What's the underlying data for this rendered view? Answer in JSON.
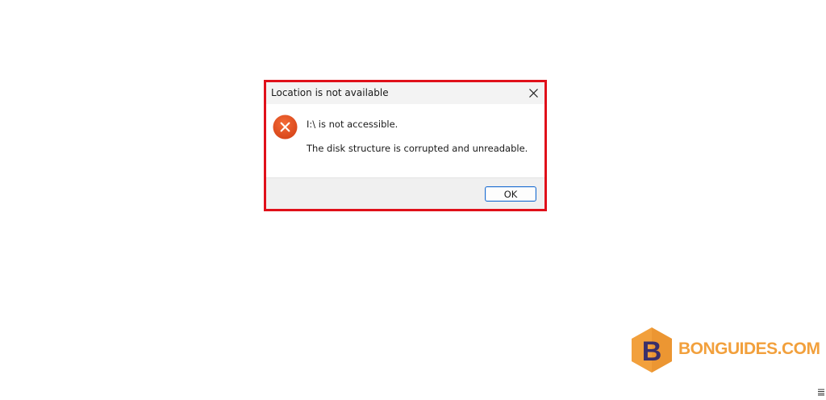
{
  "dialog": {
    "title": "Location is not available",
    "close_icon": "close-icon",
    "error_icon": "error-circle-icon",
    "message_primary": "I:\\ is not accessible.",
    "message_secondary": "The disk structure is corrupted and unreadable.",
    "ok_label": "OK"
  },
  "highlight": {
    "color": "#e0101a"
  },
  "watermark": {
    "logo_letter": "B",
    "text": "BONGUIDES.COM",
    "color": "#f2a03c"
  },
  "colors": {
    "error_red": "#e0541f",
    "ok_border": "#1f6fd1",
    "footer_bg": "#f0f0f0",
    "titlebar_bg": "#f3f3f3"
  }
}
